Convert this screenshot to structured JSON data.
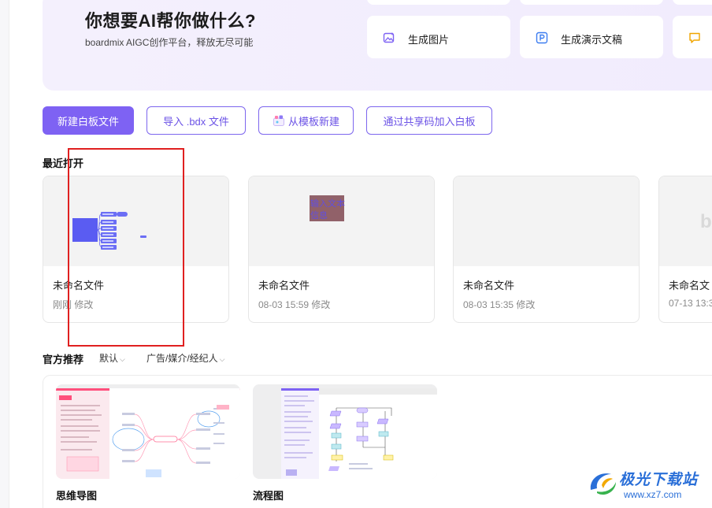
{
  "hero": {
    "title": "你想要AI帮你做什么?",
    "subtitle": "boardmix AIGC创作平台，释放无尽可能"
  },
  "ai_cards": [
    {
      "label": "生成图片",
      "icon": "image-sparkle-icon"
    },
    {
      "label": "生成演示文稿",
      "icon": "presentation-icon"
    },
    {
      "label": "",
      "icon": "chat-bubble-icon"
    }
  ],
  "actions": {
    "new_board": "新建白板文件",
    "import_bdx": "导入 .bdx 文件",
    "from_template": "从模板新建",
    "join_by_code": "通过共享码加入白板"
  },
  "recent": {
    "title": "最近打开",
    "files": [
      {
        "name": "未命名文件",
        "time": "刚刚 修改"
      },
      {
        "name": "未命名文件",
        "time": "08-03 15:59 修改",
        "thumb_text_1": "输入文本",
        "thumb_text_2": "信息"
      },
      {
        "name": "未命名文件",
        "time": "08-03 15:35 修改"
      },
      {
        "name": "未命名文",
        "time": "07-13 13:3",
        "thumb_text": "b"
      }
    ]
  },
  "recommend": {
    "title": "官方推荐",
    "filter_sort": "默认",
    "filter_category": "广告/媒介/经纪人",
    "templates": [
      {
        "name": "思维导图"
      },
      {
        "name": "流程图"
      }
    ]
  },
  "watermark": {
    "title": "极光下载站",
    "url": "www.xz7.com"
  },
  "colors": {
    "accent": "#7e62f3",
    "hero_bg": "#f3effd",
    "annotation_red": "#e02020"
  }
}
